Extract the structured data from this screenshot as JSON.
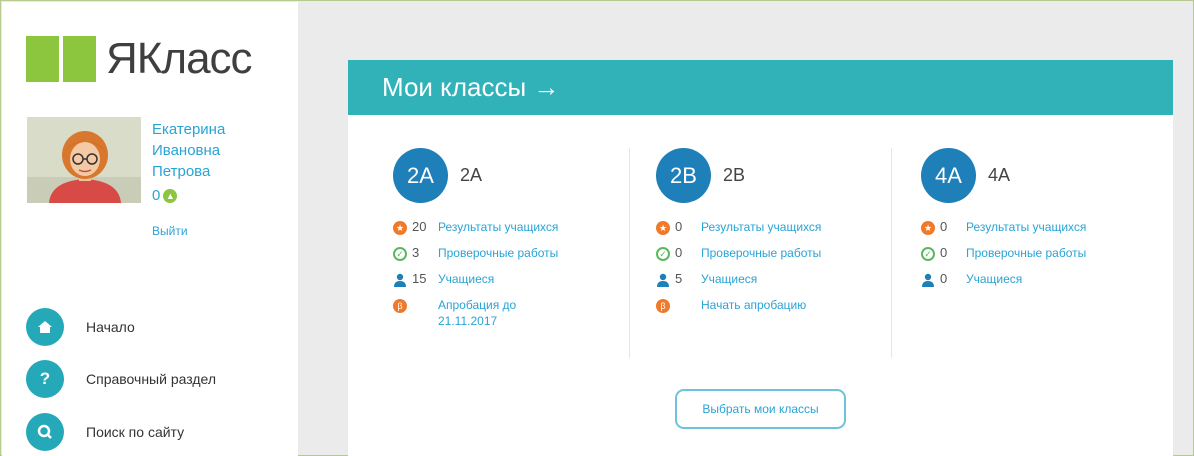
{
  "brand": {
    "name": "ЯКласс",
    "color": "#8cc63f"
  },
  "user": {
    "name_line1": "Екатерина",
    "name_line2": "Ивановна",
    "name_line3": "Петрова",
    "points": "0",
    "logout": "Выйти"
  },
  "nav": [
    {
      "label": "Начало",
      "icon": "home-icon",
      "glyph": "⌂"
    },
    {
      "label": "Справочный раздел",
      "icon": "help-icon",
      "glyph": "?"
    },
    {
      "label": "Поиск по сайту",
      "icon": "search-icon",
      "glyph": "○"
    }
  ],
  "main": {
    "title": "Мои классы →",
    "select_button": "Выбрать мои классы",
    "header_color": "#31b2b8"
  },
  "classes": [
    {
      "badge": "2А",
      "name": "2А",
      "results_count": "20",
      "results_label": "Результаты учащихся",
      "tests_count": "3",
      "tests_label": "Проверочные работы",
      "students_count": "15",
      "students_label": "Учащиеся",
      "approbation_line1": "Апробация до",
      "approbation_line2": "21.11.2017"
    },
    {
      "badge": "2В",
      "name": "2В",
      "results_count": "0",
      "results_label": "Результаты учащихся",
      "tests_count": "0",
      "tests_label": "Проверочные работы",
      "students_count": "5",
      "students_label": "Учащиеся",
      "approbation_line1": "Начать апробацию",
      "approbation_line2": ""
    },
    {
      "badge": "4А",
      "name": "4А",
      "results_count": "0",
      "results_label": "Результаты учащихся",
      "tests_count": "0",
      "tests_label": "Проверочные работы",
      "students_count": "0",
      "students_label": "Учащиеся"
    }
  ]
}
